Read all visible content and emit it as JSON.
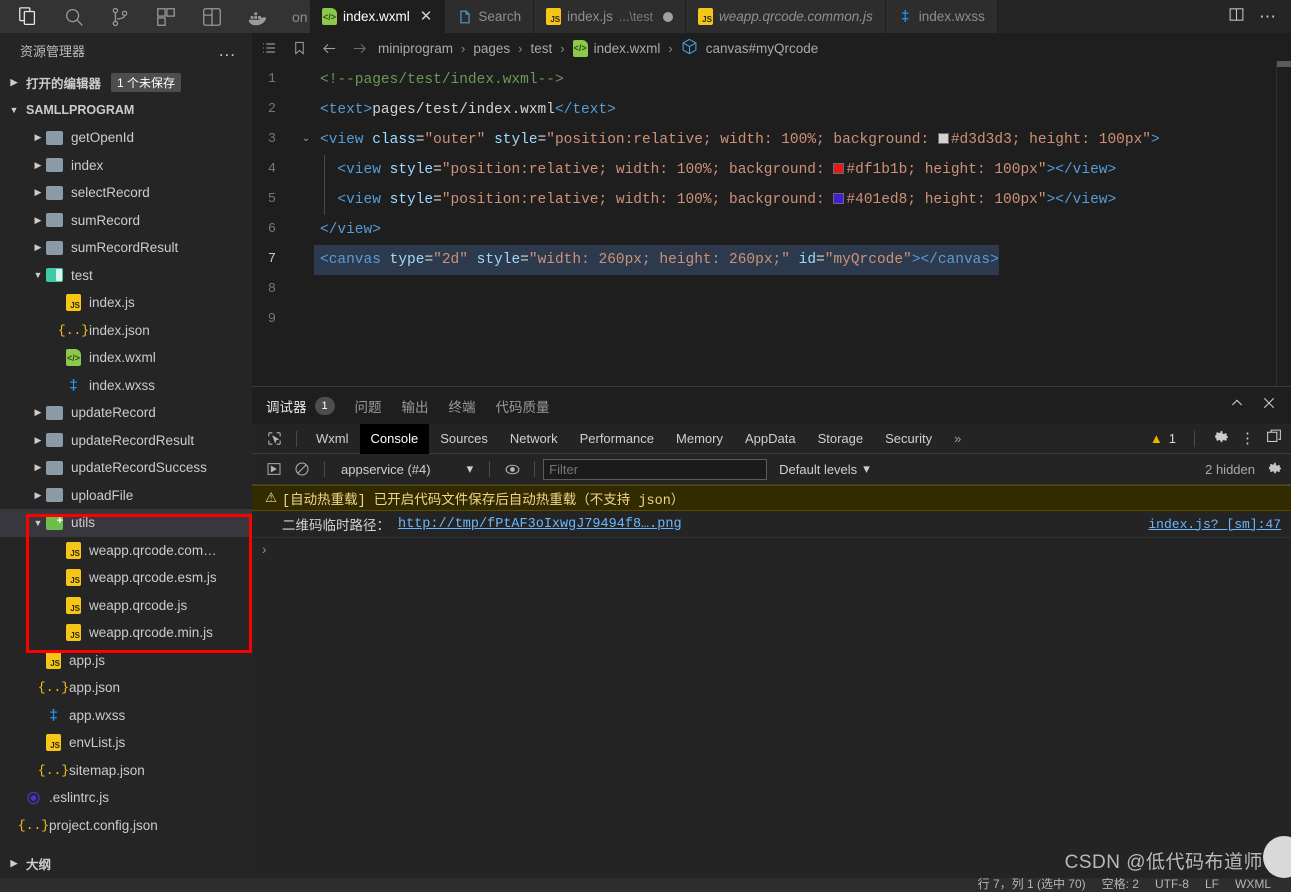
{
  "activity_bar": {
    "icons": [
      {
        "name": "explorer-icon",
        "label": "资源管理器"
      },
      {
        "name": "search-icon",
        "label": "搜索"
      },
      {
        "name": "source-control-icon",
        "label": "源代码管理"
      },
      {
        "name": "extensions-icon",
        "label": "扩展"
      },
      {
        "name": "miniprogram-icon",
        "label": "小程序"
      },
      {
        "name": "docker-icon",
        "label": "Docker"
      }
    ],
    "trailing_text": "on"
  },
  "tabs": [
    {
      "label": "index.wxml",
      "sub": "",
      "icon": "wxml",
      "active": true,
      "dirty": false,
      "closeable": true,
      "italic": false
    },
    {
      "label": "Search",
      "sub": "",
      "icon": "page",
      "active": false,
      "dirty": false,
      "closeable": false,
      "italic": false
    },
    {
      "label": "index.js",
      "sub": "...\\test",
      "icon": "js",
      "active": false,
      "dirty": true,
      "closeable": false,
      "italic": false
    },
    {
      "label": "weapp.qrcode.common.js",
      "sub": "",
      "icon": "js",
      "active": false,
      "dirty": false,
      "closeable": false,
      "italic": true
    },
    {
      "label": "index.wxss",
      "sub": "",
      "icon": "wxss",
      "active": false,
      "dirty": false,
      "closeable": false,
      "italic": false
    }
  ],
  "tab_actions": {
    "split_editor": "split-editor-icon",
    "more": "more-actions-icon"
  },
  "sidebar": {
    "title": "资源管理器",
    "more_label": "...",
    "open_editors": {
      "label": "打开的编辑器",
      "badge": "1 个未保存"
    },
    "project_name": "SAMLLPROGRAM",
    "outline_label": "大纲",
    "tree": [
      {
        "label": "getOpenId",
        "type": "folder",
        "indent": 1,
        "expanded": false
      },
      {
        "label": "index",
        "type": "folder",
        "indent": 1,
        "expanded": false
      },
      {
        "label": "selectRecord",
        "type": "folder",
        "indent": 1,
        "expanded": false
      },
      {
        "label": "sumRecord",
        "type": "folder",
        "indent": 1,
        "expanded": false
      },
      {
        "label": "sumRecordResult",
        "type": "folder",
        "indent": 1,
        "expanded": false
      },
      {
        "label": "test",
        "type": "folder-open",
        "indent": 1,
        "expanded": true
      },
      {
        "label": "index.js",
        "type": "js",
        "indent": 2
      },
      {
        "label": "index.json",
        "type": "json",
        "indent": 2
      },
      {
        "label": "index.wxml",
        "type": "wxml",
        "indent": 2
      },
      {
        "label": "index.wxss",
        "type": "wxss",
        "indent": 2
      },
      {
        "label": "updateRecord",
        "type": "folder",
        "indent": 1,
        "expanded": false
      },
      {
        "label": "updateRecordResult",
        "type": "folder",
        "indent": 1,
        "expanded": false
      },
      {
        "label": "updateRecordSuccess",
        "type": "folder",
        "indent": 1,
        "expanded": false
      },
      {
        "label": "uploadFile",
        "type": "folder",
        "indent": 1,
        "expanded": false
      },
      {
        "label": "utils",
        "type": "folder-add",
        "indent": 1,
        "expanded": true,
        "selected": true
      },
      {
        "label": "weapp.qrcode.com…",
        "type": "js",
        "indent": 2
      },
      {
        "label": "weapp.qrcode.esm.js",
        "type": "js",
        "indent": 2
      },
      {
        "label": "weapp.qrcode.js",
        "type": "js",
        "indent": 2
      },
      {
        "label": "weapp.qrcode.min.js",
        "type": "js",
        "indent": 2
      },
      {
        "label": "app.js",
        "type": "js",
        "indent": 1
      },
      {
        "label": "app.json",
        "type": "json",
        "indent": 1
      },
      {
        "label": "app.wxss",
        "type": "wxss",
        "indent": 1
      },
      {
        "label": "envList.js",
        "type": "js",
        "indent": 1
      },
      {
        "label": "sitemap.json",
        "type": "json",
        "indent": 1
      },
      {
        "label": ".eslintrc.js",
        "type": "eslint",
        "indent": 0
      },
      {
        "label": "project.config.json",
        "type": "json",
        "indent": 0
      }
    ]
  },
  "breadcrumb": {
    "toggle_outline_icon": "list-icon",
    "bookmark_icon": "bookmark-icon",
    "back_icon": "arrow-left-icon",
    "forward_icon": "arrow-right-icon",
    "items": [
      "miniprogram",
      "pages",
      "test",
      "index.wxml",
      "canvas#myQrcode"
    ],
    "separator": "›"
  },
  "editor": {
    "lines": [
      {
        "num": "1",
        "fold": "",
        "selected": false,
        "tokens": [
          {
            "t": "comment",
            "v": "<!--pages/test/index.wxml-->"
          }
        ]
      },
      {
        "num": "2",
        "fold": "",
        "selected": false,
        "tokens": [
          {
            "t": "tag",
            "v": "<text>"
          },
          {
            "t": "txt",
            "v": "pages/test/index.wxml"
          },
          {
            "t": "tag",
            "v": "</text>"
          }
        ]
      },
      {
        "num": "3",
        "fold": "v",
        "selected": false,
        "tokens": [
          {
            "t": "tag",
            "v": "<view "
          },
          {
            "t": "attr",
            "v": "class"
          },
          {
            "t": "txt",
            "v": "="
          },
          {
            "t": "str",
            "v": "\"outer\""
          },
          {
            "t": "txt",
            "v": " "
          },
          {
            "t": "attr",
            "v": "style"
          },
          {
            "t": "txt",
            "v": "="
          },
          {
            "t": "str",
            "v": "\"position:relative; width: 100%; background: "
          },
          {
            "t": "swatch",
            "v": "#d3d3d3"
          },
          {
            "t": "str",
            "v": "#d3d3d3; height: 100px\""
          },
          {
            "t": "tag",
            "v": ">"
          }
        ]
      },
      {
        "num": "4",
        "fold": "",
        "selected": false,
        "indent": 1,
        "tokens": [
          {
            "t": "tag",
            "v": "<view "
          },
          {
            "t": "attr",
            "v": "style"
          },
          {
            "t": "txt",
            "v": "="
          },
          {
            "t": "str",
            "v": "\"position:relative; width: 100%; background: "
          },
          {
            "t": "swatch",
            "v": "#df1b1b"
          },
          {
            "t": "str",
            "v": "#df1b1b; height: 100px\""
          },
          {
            "t": "tag",
            "v": "></view>"
          }
        ]
      },
      {
        "num": "5",
        "fold": "",
        "selected": false,
        "indent": 1,
        "tokens": [
          {
            "t": "tag",
            "v": "<view "
          },
          {
            "t": "attr",
            "v": "style"
          },
          {
            "t": "txt",
            "v": "="
          },
          {
            "t": "str",
            "v": "\"position:relative; width: 100%; background: "
          },
          {
            "t": "swatch",
            "v": "#401ed8"
          },
          {
            "t": "str",
            "v": "#401ed8; height: 100px\""
          },
          {
            "t": "tag",
            "v": "></view>"
          }
        ]
      },
      {
        "num": "6",
        "fold": "",
        "selected": false,
        "tokens": [
          {
            "t": "tag",
            "v": "</view>"
          }
        ]
      },
      {
        "num": "7",
        "fold": "",
        "selected": true,
        "tokens": [
          {
            "t": "tag",
            "v": "<canvas "
          },
          {
            "t": "attr",
            "v": "type"
          },
          {
            "t": "txt",
            "v": "="
          },
          {
            "t": "str",
            "v": "\"2d\""
          },
          {
            "t": "txt",
            "v": " "
          },
          {
            "t": "attr",
            "v": "style"
          },
          {
            "t": "txt",
            "v": "="
          },
          {
            "t": "str",
            "v": "\"width: 260px; height: 260px;\""
          },
          {
            "t": "txt",
            "v": " "
          },
          {
            "t": "attr",
            "v": "id"
          },
          {
            "t": "txt",
            "v": "="
          },
          {
            "t": "str",
            "v": "\"myQrcode\""
          },
          {
            "t": "tag",
            "v": "></canvas>"
          }
        ]
      },
      {
        "num": "8",
        "fold": "",
        "selected": false,
        "tokens": []
      },
      {
        "num": "9",
        "fold": "",
        "selected": false,
        "tokens": []
      }
    ]
  },
  "panel": {
    "tabs": [
      {
        "label": "调试器",
        "count": "1",
        "active": true
      },
      {
        "label": "问题",
        "count": "",
        "active": false
      },
      {
        "label": "输出",
        "count": "",
        "active": false
      },
      {
        "label": "终端",
        "count": "",
        "active": false
      },
      {
        "label": "代码质量",
        "count": "",
        "active": false
      }
    ],
    "actions": [
      {
        "name": "panel-collapse-icon",
        "glyph": "⌃"
      },
      {
        "name": "panel-close-icon",
        "glyph": "✕"
      }
    ]
  },
  "devtools": {
    "inspect_icon": "inspect-element-icon",
    "tabs": [
      {
        "label": "Wxml",
        "active": false
      },
      {
        "label": "Console",
        "active": true
      },
      {
        "label": "Sources",
        "active": false
      },
      {
        "label": "Network",
        "active": false
      },
      {
        "label": "Performance",
        "active": false
      },
      {
        "label": "Memory",
        "active": false
      },
      {
        "label": "AppData",
        "active": false
      },
      {
        "label": "Storage",
        "active": false
      },
      {
        "label": "Security",
        "active": false
      }
    ],
    "overflow_label": "»",
    "warning_count": "1",
    "settings_icon": "gear-icon",
    "more_icon": "kebab-menu-icon",
    "dock_icon": "dock-panel-icon",
    "toolbar": {
      "execute_icon": "execute-step-icon",
      "clear_icon": "clear-console-icon",
      "context": "appservice (#4)",
      "context_caret": "▾",
      "eye_icon": "live-expression-icon",
      "filter_placeholder": "Filter",
      "filter_value": "",
      "levels": "Default levels",
      "levels_caret": "▾",
      "hidden_count": "2 hidden",
      "settings_icon": "console-settings-icon"
    },
    "messages": [
      {
        "type": "warning",
        "icon": "warning-triangle-icon",
        "text": "[自动热重载] 已开启代码文件保存后自动热重载（不支持 json）",
        "source": ""
      },
      {
        "type": "info",
        "icon": "",
        "text": "二维码临时路径：",
        "link": "http://tmp/fPtAF3oIxwgJ79494f8….png",
        "source": "index.js? [sm]:47"
      }
    ],
    "prompt": "›"
  },
  "statusbar": {
    "items": [
      "行 7，列 1 (选中 70)",
      "空格: 2",
      "UTF-8",
      "LF",
      "WXML"
    ]
  },
  "watermark": "CSDN @低代码布道师",
  "colors": {
    "annotation": "#fd0000",
    "accent_green": "#8cc84b",
    "accent_yellow": "#f5c518",
    "accent_blue": "#569cd6",
    "swatch_gray": "#d3d3d3",
    "swatch_red": "#df1b1b",
    "swatch_purple": "#401ed8"
  }
}
